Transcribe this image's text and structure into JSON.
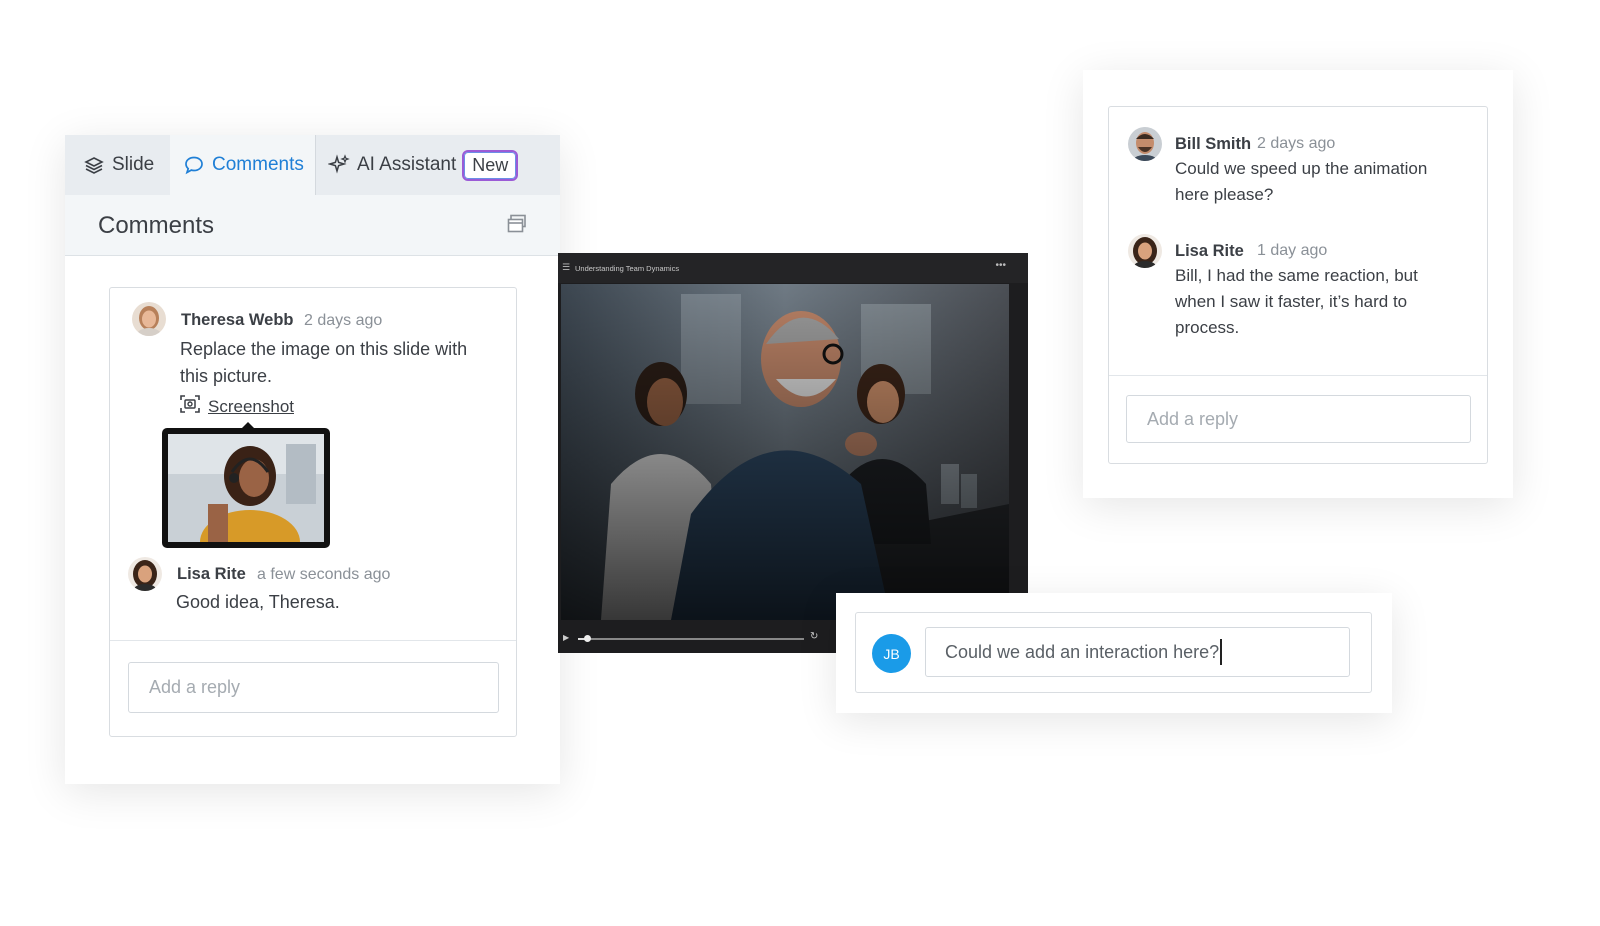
{
  "tabs": [
    {
      "label": "Slide",
      "icon": "layers-icon"
    },
    {
      "label": "Comments",
      "icon": "speech-bubble-icon"
    },
    {
      "label": "AI Assistant",
      "icon": "sparkles-icon",
      "badge": "New"
    }
  ],
  "active_tab": "Comments",
  "panel": {
    "title": "Comments"
  },
  "left_thread": {
    "comments": [
      {
        "author": "Theresa Webb",
        "time": "2 days ago",
        "text": "Replace the image on this slide with this picture.",
        "attachment_label": "Screenshot"
      },
      {
        "author": "Lisa Rite",
        "time": "a few seconds ago",
        "text": "Good idea, Theresa."
      }
    ],
    "reply_placeholder": "Add a reply"
  },
  "player": {
    "title": "Understanding Team Dynamics",
    "progress": 0.04
  },
  "right_thread": {
    "comments": [
      {
        "author": "Bill Smith",
        "time": "2 days ago",
        "text": "Could we speed up the animation here please?"
      },
      {
        "author": "Lisa Rite",
        "time": "1 day ago",
        "text": "Bill, I had the same reaction, but when I saw it faster, it’s hard to process."
      }
    ],
    "reply_placeholder": "Add a reply"
  },
  "new_comment": {
    "initials": "JB",
    "value": "Could we add an interaction here?"
  },
  "colors": {
    "accent": "#1f7fd6",
    "avatar_jb": "#1a9be8",
    "badge_border": "#9b5bd6"
  }
}
